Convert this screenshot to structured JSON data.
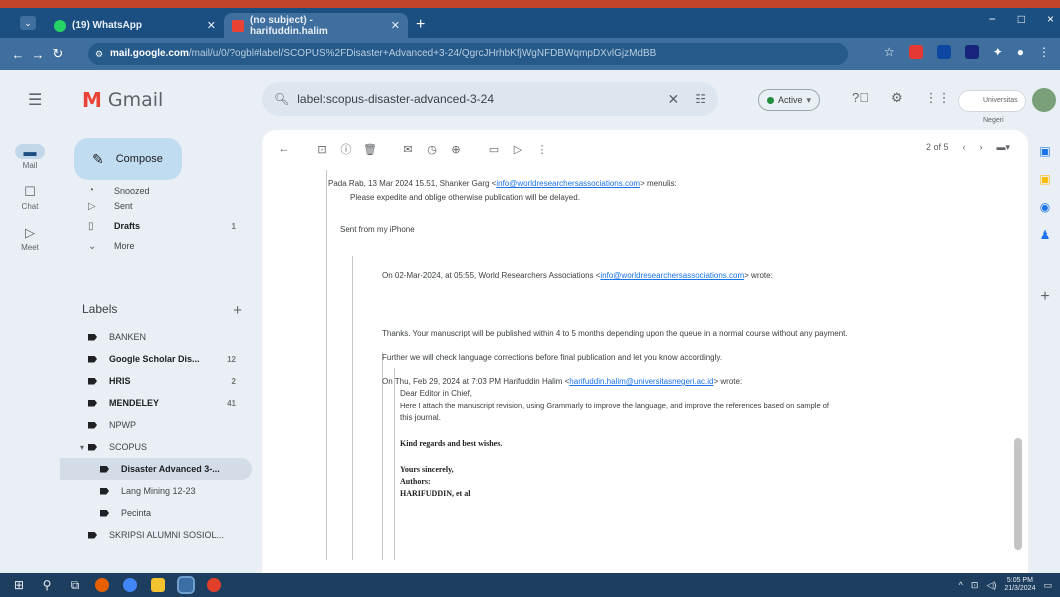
{
  "browser": {
    "tabs": [
      {
        "title": "(19) WhatsApp",
        "favicon_color": "#25d366"
      },
      {
        "title": "(no subject) - harifuddin.halim",
        "favicon_color": "#ea4335"
      }
    ],
    "new_tab": "+",
    "url_host": "mail.google.com",
    "url_path": "/mail/u/0/?ogbl#label/SCOPUS%2FDisaster+Advanced+3-24/QgrcJHrhbKfjWgNFDBWqmpDXvlGjzMdBB",
    "window_controls": [
      "−",
      "□",
      "×"
    ]
  },
  "gmail": {
    "brand": "Gmail",
    "search": {
      "value": "label:scopus-disaster-advanced-3-24"
    },
    "status": {
      "label": "Active"
    },
    "account_label": "Universitas Negeri",
    "compose_label": "Compose",
    "rail": [
      {
        "glyph": "▬",
        "label": "Mail"
      },
      {
        "glyph": "☐",
        "label": "Chat"
      },
      {
        "glyph": "▷",
        "label": "Meet"
      }
    ],
    "nav": [
      {
        "label": "Snoozed",
        "icon": "◔",
        "count": ""
      },
      {
        "label": "Sent",
        "icon": "▷",
        "count": ""
      },
      {
        "label": "Drafts",
        "icon": "▯",
        "count": "1"
      },
      {
        "label": "More",
        "icon": "⌄",
        "count": ""
      }
    ],
    "labels_title": "Labels",
    "labels": [
      {
        "label": "BANKEN",
        "count": "",
        "bold": false
      },
      {
        "label": "Google Scholar Dis...",
        "count": "12",
        "bold": true
      },
      {
        "label": "HRIS",
        "count": "2",
        "bold": true
      },
      {
        "label": "MENDELEY",
        "count": "41",
        "bold": true
      },
      {
        "label": "NPWP",
        "count": "",
        "bold": false
      },
      {
        "label": "SCOPUS",
        "count": "",
        "bold": false
      },
      {
        "label": "Disaster Advanced 3-...",
        "count": "",
        "bold": true
      },
      {
        "label": "Lang Mining 12-23",
        "count": "",
        "bold": false
      },
      {
        "label": "Pecinta",
        "count": "",
        "bold": false
      },
      {
        "label": "SKRIPSI ALUMNI SOSIOL...",
        "count": "",
        "bold": false
      }
    ],
    "pager": "2 of 5",
    "message": {
      "l1_prefix": "Pada Rab, 13 Mar 2024 15.51, Shanker Garg <",
      "l1_email": "info@worldresearchersassociations.com",
      "l1_suffix": "> menulis:",
      "l2": "Please expedite and oblige otherwise publication will be delayed.",
      "l3": "Sent from my iPhone",
      "l4_prefix": "On 02-Mar-2024, at 05:55, World Researchers Associations <",
      "l4_email": "info@worldresearchersassociations.com",
      "l4_suffix": "> wrote:",
      "l5": "Thanks. Your manuscript will be published within 4 to 5 months depending upon the queue in a normal course without any payment.",
      "l6": "Further we will check language corrections before final publication and let you know accordingly.",
      "l7_prefix": "On Thu, Feb 29, 2024 at 7:03 PM Harifuddin Halim <",
      "l7_email": "harifuddin.halim@universitasnegeri.ac.id",
      "l7_suffix": "> wrote:",
      "l8": "Dear Editor in Chief,",
      "l9": "Here I attach the manuscript revision, using Grammarly to improve the language, and improve the references based on sample of",
      "l10": "this journal.",
      "l11": "Kind regards and best wishes.",
      "l12": "Yours sincerely,",
      "l13": "Authors:",
      "l14": "HARIFUDDIN, et al"
    }
  },
  "taskbar": {
    "time": "5:05 PM",
    "date": "21/3/2024"
  }
}
